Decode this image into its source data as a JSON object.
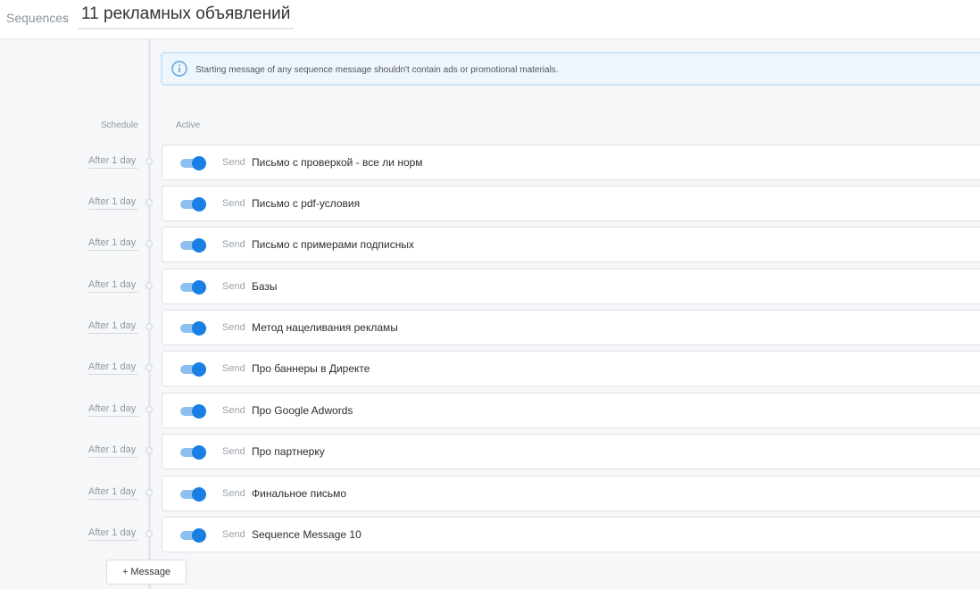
{
  "header": {
    "breadcrumb": "Sequences",
    "title": "11 рекламных объявлений"
  },
  "notice": {
    "icon": "info-icon",
    "text": "Starting message of any sequence message shouldn't contain ads or promotional materials."
  },
  "columns": {
    "schedule": "Schedule",
    "active": "Active"
  },
  "accent_color": "#1a7fe3",
  "messages": [
    {
      "schedule": "After 1 day",
      "action": "Send",
      "name": "Письмо с проверкой - все ли норм",
      "active": true
    },
    {
      "schedule": "After 1 day",
      "action": "Send",
      "name": "Письмо с pdf-условия",
      "active": true
    },
    {
      "schedule": "After 1 day",
      "action": "Send",
      "name": "Письмо с примерами подписных",
      "active": true
    },
    {
      "schedule": "After 1 day",
      "action": "Send",
      "name": "Базы",
      "active": true
    },
    {
      "schedule": "After 1 day",
      "action": "Send",
      "name": "Метод нацеливания рекламы",
      "active": true
    },
    {
      "schedule": "After 1 day",
      "action": "Send",
      "name": "Про баннеры в Директе",
      "active": true
    },
    {
      "schedule": "After 1 day",
      "action": "Send",
      "name": "Про Google Adwords",
      "active": true
    },
    {
      "schedule": "After 1 day",
      "action": "Send",
      "name": "Про партнерку",
      "active": true
    },
    {
      "schedule": "After 1 day",
      "action": "Send",
      "name": "Финальное письмо",
      "active": true
    },
    {
      "schedule": "After 1 day",
      "action": "Send",
      "name": "Sequence Message 10",
      "active": true
    }
  ],
  "add_button": "+ Message"
}
